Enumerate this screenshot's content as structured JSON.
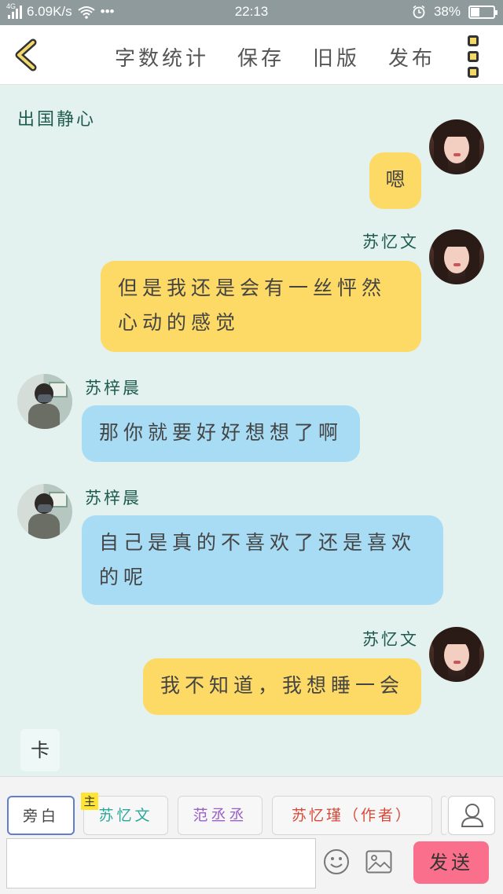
{
  "status_bar": {
    "network": "4G",
    "speed": "6.09K/s",
    "dots": "•••",
    "time": "22:13",
    "battery": "38%",
    "battery_level": 0.38
  },
  "header": {
    "actions": [
      "字数统计",
      "保存",
      "旧版",
      "发布"
    ]
  },
  "chat": {
    "title": "出国静心",
    "messages": [
      {
        "sender": "",
        "side": "right",
        "text": "嗯",
        "color": "#fdd966"
      },
      {
        "sender": "苏忆文",
        "side": "right",
        "text": "但是我还是会有一丝怦然心动的感觉",
        "color": "#fdd966"
      },
      {
        "sender": "苏梓晨",
        "side": "left",
        "text": "那你就要好好想想了啊",
        "color": "#a8dcf5"
      },
      {
        "sender": "苏梓晨",
        "side": "left",
        "text": "自己是真的不喜欢了还是喜欢的呢",
        "color": "#a8dcf5"
      },
      {
        "sender": "苏忆文",
        "side": "right",
        "text": "我不知道，我想睡一会",
        "color": "#fdd966"
      }
    ],
    "card_label": "卡"
  },
  "roles": [
    {
      "label": "旁白",
      "color": "#444444",
      "selected": true
    },
    {
      "label": "苏忆文",
      "color": "#2aa89a",
      "tag": "主"
    },
    {
      "label": "范丞丞",
      "color": "#9b5fc8"
    },
    {
      "label": "苏忆瑾（作者）",
      "color": "#d84a3a"
    }
  ],
  "input": {
    "value": "",
    "placeholder": ""
  },
  "send_label": "发送"
}
